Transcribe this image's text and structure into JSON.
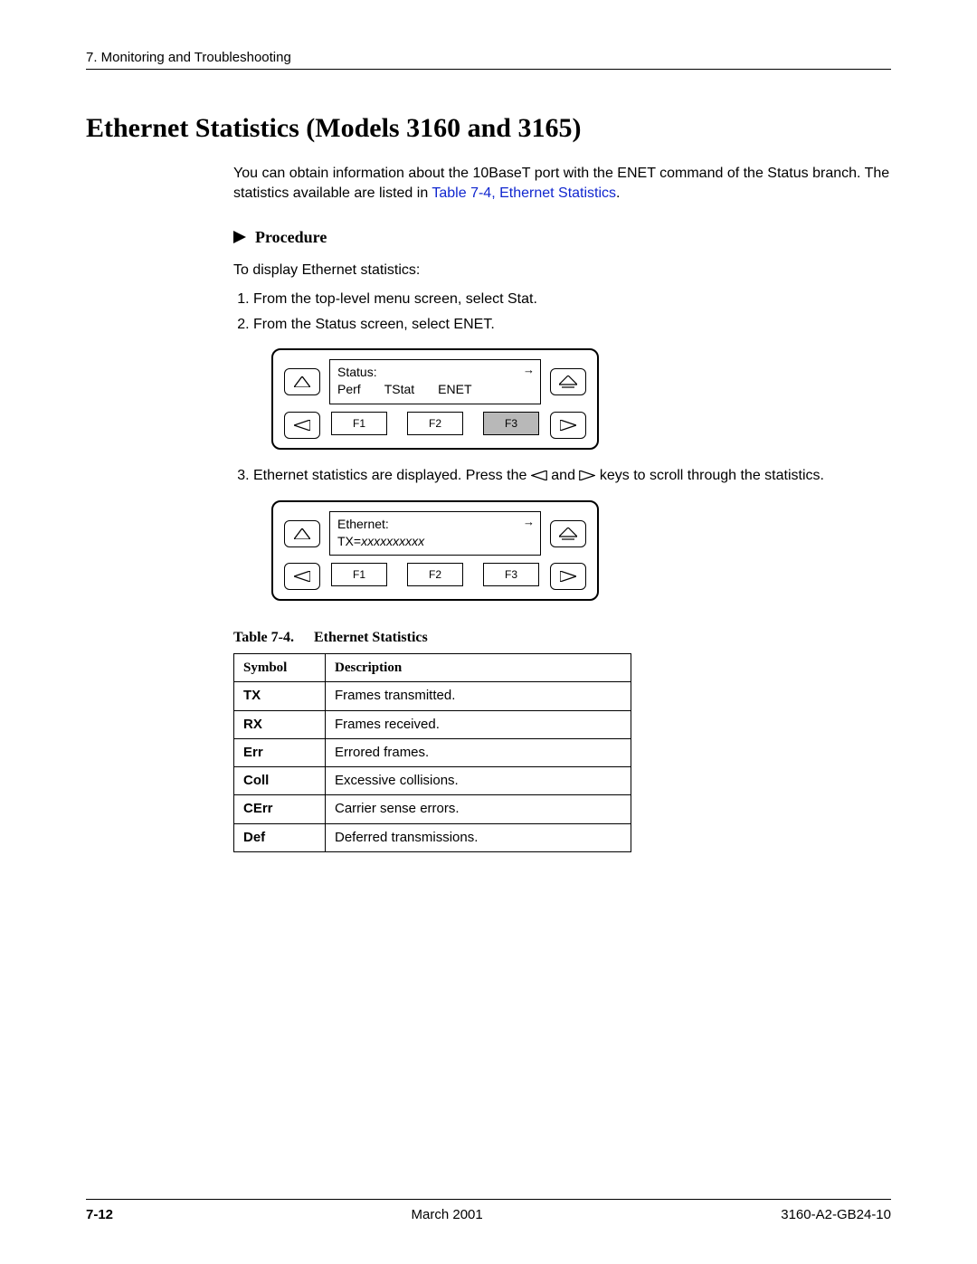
{
  "header": {
    "chapter": "7. Monitoring and Troubleshooting"
  },
  "title": "Ethernet Statistics (Models 3160 and 3165)",
  "intro": {
    "pre": "You can obtain information about the 10BaseT port with the ENET command of the Status branch. The statistics available are listed in ",
    "xref": "Table 7-4, Ethernet Statistics",
    "post": "."
  },
  "procedure": {
    "label": "Procedure",
    "lead": "To display Ethernet statistics:",
    "steps": {
      "s1": "From the top-level menu screen, select Stat.",
      "s2": "From the Status screen, select ENET.",
      "s3a": "Ethernet statistics are displayed. Press the ",
      "s3b": " and ",
      "s3c": " keys to scroll through the statistics."
    }
  },
  "panel1": {
    "title": "Status:",
    "items": {
      "a": "Perf",
      "b": "TStat",
      "c": "ENET"
    },
    "fkeys": {
      "f1": "F1",
      "f2": "F2",
      "f3": "F3"
    }
  },
  "panel2": {
    "title": "Ethernet:",
    "txlabel": "TX=",
    "txval": "xxxxxxxxxx",
    "fkeys": {
      "f1": "F1",
      "f2": "F2",
      "f3": "F3"
    }
  },
  "table": {
    "caption_num": "Table 7-4.",
    "caption_title": "Ethernet Statistics",
    "head": {
      "c1": "Symbol",
      "c2": "Description"
    },
    "rows": [
      {
        "sym": "TX",
        "desc": "Frames transmitted."
      },
      {
        "sym": "RX",
        "desc": "Frames received."
      },
      {
        "sym": "Err",
        "desc": "Errored frames."
      },
      {
        "sym": "Coll",
        "desc": "Excessive collisions."
      },
      {
        "sym": "CErr",
        "desc": "Carrier sense errors."
      },
      {
        "sym": "Def",
        "desc": "Deferred transmissions."
      }
    ]
  },
  "footer": {
    "page": "7-12",
    "date": "March 2001",
    "docnum": "3160-A2-GB24-10"
  },
  "icons": {
    "up": "up-triangle-icon",
    "home": "home-up-icon",
    "left": "left-triangle-icon",
    "right": "right-triangle-icon"
  }
}
